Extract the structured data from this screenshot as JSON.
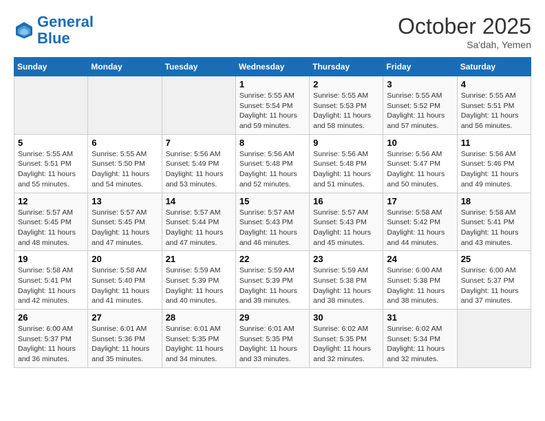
{
  "header": {
    "logo_line1": "General",
    "logo_line2": "Blue",
    "month": "October 2025",
    "location": "Sa'dah, Yemen"
  },
  "days_of_week": [
    "Sunday",
    "Monday",
    "Tuesday",
    "Wednesday",
    "Thursday",
    "Friday",
    "Saturday"
  ],
  "weeks": [
    [
      {
        "day": "",
        "info": ""
      },
      {
        "day": "",
        "info": ""
      },
      {
        "day": "",
        "info": ""
      },
      {
        "day": "1",
        "info": "Sunrise: 5:55 AM\nSunset: 5:54 PM\nDaylight: 11 hours and 59 minutes."
      },
      {
        "day": "2",
        "info": "Sunrise: 5:55 AM\nSunset: 5:53 PM\nDaylight: 11 hours and 58 minutes."
      },
      {
        "day": "3",
        "info": "Sunrise: 5:55 AM\nSunset: 5:52 PM\nDaylight: 11 hours and 57 minutes."
      },
      {
        "day": "4",
        "info": "Sunrise: 5:55 AM\nSunset: 5:51 PM\nDaylight: 11 hours and 56 minutes."
      }
    ],
    [
      {
        "day": "5",
        "info": "Sunrise: 5:55 AM\nSunset: 5:51 PM\nDaylight: 11 hours and 55 minutes."
      },
      {
        "day": "6",
        "info": "Sunrise: 5:55 AM\nSunset: 5:50 PM\nDaylight: 11 hours and 54 minutes."
      },
      {
        "day": "7",
        "info": "Sunrise: 5:56 AM\nSunset: 5:49 PM\nDaylight: 11 hours and 53 minutes."
      },
      {
        "day": "8",
        "info": "Sunrise: 5:56 AM\nSunset: 5:48 PM\nDaylight: 11 hours and 52 minutes."
      },
      {
        "day": "9",
        "info": "Sunrise: 5:56 AM\nSunset: 5:48 PM\nDaylight: 11 hours and 51 minutes."
      },
      {
        "day": "10",
        "info": "Sunrise: 5:56 AM\nSunset: 5:47 PM\nDaylight: 11 hours and 50 minutes."
      },
      {
        "day": "11",
        "info": "Sunrise: 5:56 AM\nSunset: 5:46 PM\nDaylight: 11 hours and 49 minutes."
      }
    ],
    [
      {
        "day": "12",
        "info": "Sunrise: 5:57 AM\nSunset: 5:45 PM\nDaylight: 11 hours and 48 minutes."
      },
      {
        "day": "13",
        "info": "Sunrise: 5:57 AM\nSunset: 5:45 PM\nDaylight: 11 hours and 47 minutes."
      },
      {
        "day": "14",
        "info": "Sunrise: 5:57 AM\nSunset: 5:44 PM\nDaylight: 11 hours and 47 minutes."
      },
      {
        "day": "15",
        "info": "Sunrise: 5:57 AM\nSunset: 5:43 PM\nDaylight: 11 hours and 46 minutes."
      },
      {
        "day": "16",
        "info": "Sunrise: 5:57 AM\nSunset: 5:43 PM\nDaylight: 11 hours and 45 minutes."
      },
      {
        "day": "17",
        "info": "Sunrise: 5:58 AM\nSunset: 5:42 PM\nDaylight: 11 hours and 44 minutes."
      },
      {
        "day": "18",
        "info": "Sunrise: 5:58 AM\nSunset: 5:41 PM\nDaylight: 11 hours and 43 minutes."
      }
    ],
    [
      {
        "day": "19",
        "info": "Sunrise: 5:58 AM\nSunset: 5:41 PM\nDaylight: 11 hours and 42 minutes."
      },
      {
        "day": "20",
        "info": "Sunrise: 5:58 AM\nSunset: 5:40 PM\nDaylight: 11 hours and 41 minutes."
      },
      {
        "day": "21",
        "info": "Sunrise: 5:59 AM\nSunset: 5:39 PM\nDaylight: 11 hours and 40 minutes."
      },
      {
        "day": "22",
        "info": "Sunrise: 5:59 AM\nSunset: 5:39 PM\nDaylight: 11 hours and 39 minutes."
      },
      {
        "day": "23",
        "info": "Sunrise: 5:59 AM\nSunset: 5:38 PM\nDaylight: 11 hours and 38 minutes."
      },
      {
        "day": "24",
        "info": "Sunrise: 6:00 AM\nSunset: 5:38 PM\nDaylight: 11 hours and 38 minutes."
      },
      {
        "day": "25",
        "info": "Sunrise: 6:00 AM\nSunset: 5:37 PM\nDaylight: 11 hours and 37 minutes."
      }
    ],
    [
      {
        "day": "26",
        "info": "Sunrise: 6:00 AM\nSunset: 5:37 PM\nDaylight: 11 hours and 36 minutes."
      },
      {
        "day": "27",
        "info": "Sunrise: 6:01 AM\nSunset: 5:36 PM\nDaylight: 11 hours and 35 minutes."
      },
      {
        "day": "28",
        "info": "Sunrise: 6:01 AM\nSunset: 5:35 PM\nDaylight: 11 hours and 34 minutes."
      },
      {
        "day": "29",
        "info": "Sunrise: 6:01 AM\nSunset: 5:35 PM\nDaylight: 11 hours and 33 minutes."
      },
      {
        "day": "30",
        "info": "Sunrise: 6:02 AM\nSunset: 5:35 PM\nDaylight: 11 hours and 32 minutes."
      },
      {
        "day": "31",
        "info": "Sunrise: 6:02 AM\nSunset: 5:34 PM\nDaylight: 11 hours and 32 minutes."
      },
      {
        "day": "",
        "info": ""
      }
    ]
  ]
}
